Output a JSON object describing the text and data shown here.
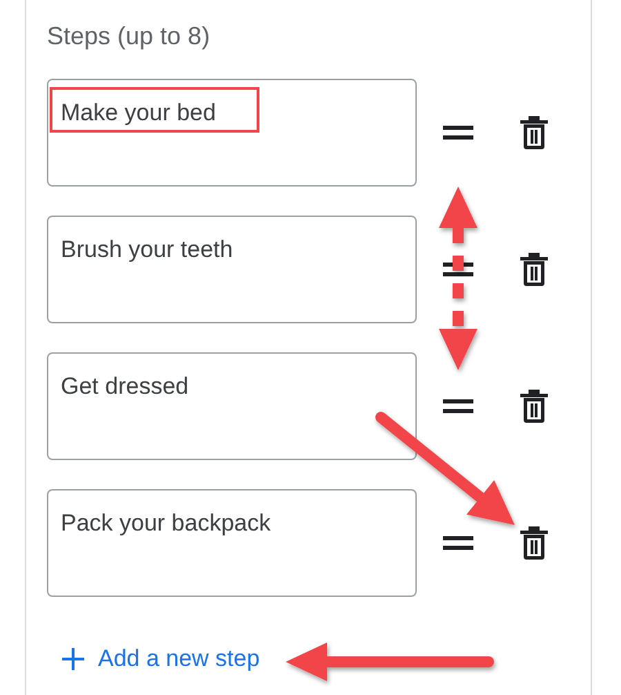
{
  "section": {
    "label": "Steps (up to 8)",
    "steps": [
      {
        "text": "Make your bed"
      },
      {
        "text": "Brush your teeth"
      },
      {
        "text": "Get dressed"
      },
      {
        "text": "Pack your backpack"
      }
    ],
    "add_step": {
      "label": "Add a new step"
    }
  },
  "annotations": [
    {
      "kind": "box"
    },
    {
      "kind": "double-arrow"
    },
    {
      "kind": "diagonal-arrow"
    },
    {
      "kind": "left-arrow"
    }
  ]
}
